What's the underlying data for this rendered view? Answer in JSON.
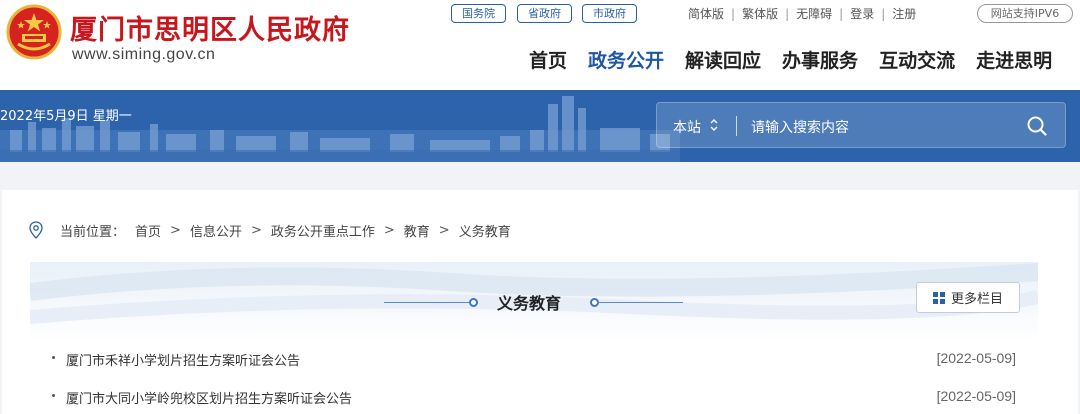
{
  "header": {
    "site_title": "厦门市思明区人民政府",
    "site_url": "www.siming.gov.cn",
    "emblem_icon": "national-emblem-icon",
    "top_links": [
      {
        "label": "国务院"
      },
      {
        "label": "省政府"
      },
      {
        "label": "市政府"
      }
    ],
    "utility": [
      "简体版",
      "繁体版",
      "无障碍",
      "登录",
      "注册"
    ],
    "ipv6_badge": "网站支持IPV6",
    "nav": [
      {
        "label": "首页",
        "active": false
      },
      {
        "label": "政务公开",
        "active": true
      },
      {
        "label": "解读回应",
        "active": false
      },
      {
        "label": "办事服务",
        "active": false
      },
      {
        "label": "互动交流",
        "active": false
      },
      {
        "label": "走进思明",
        "active": false
      }
    ]
  },
  "banner": {
    "date_text": "2022年5月9日 星期一",
    "search": {
      "scope": "本站",
      "placeholder": "请输入搜索内容",
      "icon": "search-icon"
    }
  },
  "breadcrumb": {
    "prefix": "当前位置：",
    "icon": "location-pin-icon",
    "items": [
      "首页",
      "信息公开",
      "政务公开重点工作",
      "教育",
      "义务教育"
    ]
  },
  "section": {
    "title": "义务教育",
    "more_label": "更多栏目",
    "more_icon": "grid-icon"
  },
  "articles": [
    {
      "title": "厦门市禾祥小学划片招生方案听证会公告",
      "date": "[2022-05-09]"
    },
    {
      "title": "厦门市大同小学岭兜校区划片招生方案听证会公告",
      "date": "[2022-05-09]"
    }
  ],
  "colors": {
    "brand_red": "#c8161d",
    "brand_blue": "#1f56a6",
    "banner_blue": "#2c63ab"
  }
}
